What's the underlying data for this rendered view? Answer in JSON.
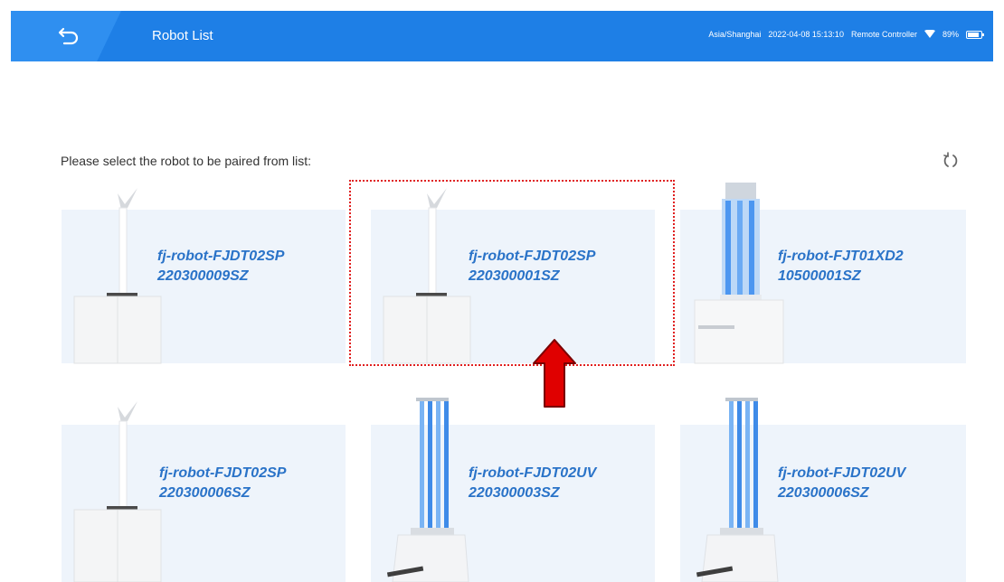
{
  "header": {
    "title": "Robot List",
    "timezone": "Asia/Shanghai",
    "datetime": "2022-04-08 15:13:10",
    "controller": "Remote Controller",
    "battery": "89%",
    "battery_level": 0.89,
    "accent_color": "#1e7fe6"
  },
  "prompt": "Please select the robot to be paired from list:",
  "robots": [
    {
      "name": "fj-robot-FJDT02SP",
      "serial": "220300009SZ",
      "model": "arm-robot"
    },
    {
      "name": "fj-robot-FJDT02SP",
      "serial": "220300001SZ",
      "model": "arm-robot"
    },
    {
      "name": "fj-robot-FJT01XD2",
      "serial": "10500001SZ",
      "model": "uv-tower-robot"
    },
    {
      "name": "fj-robot-FJDT02SP",
      "serial": "220300006SZ",
      "model": "arm-robot"
    },
    {
      "name": "fj-robot-FJDT02UV",
      "serial": "220300003SZ",
      "model": "uv-lamp-robot"
    },
    {
      "name": "fj-robot-FJDT02UV",
      "serial": "220300006SZ",
      "model": "uv-lamp-robot"
    }
  ],
  "icons": [
    "back-icon",
    "wifi-icon",
    "battery-icon",
    "refresh-icon"
  ],
  "annotation": {
    "highlight_color": "#e02020",
    "arrow_color": "#e00000",
    "highlighted_robot_index": 1
  }
}
